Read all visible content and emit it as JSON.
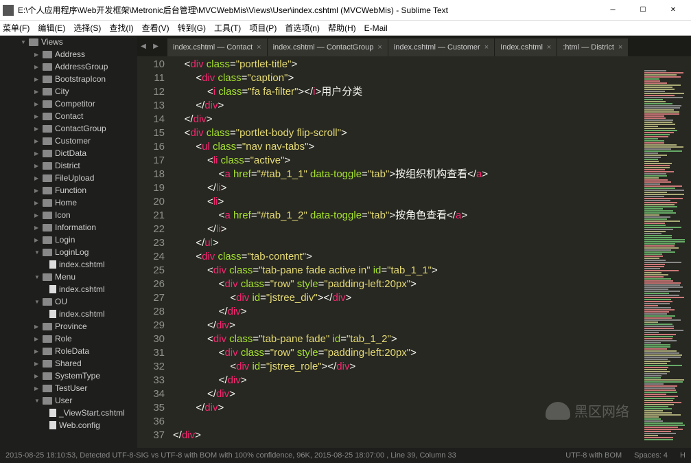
{
  "window": {
    "title": "E:\\个人应用程序\\Web开发框架\\Metronic后台管理\\MVCWebMis\\Views\\User\\index.cshtml (MVCWebMis) - Sublime Text"
  },
  "menu": [
    "菜单(F)",
    "编辑(E)",
    "选择(S)",
    "查找(I)",
    "查看(V)",
    "转到(G)",
    "工具(T)",
    "项目(P)",
    "首选项(n)",
    "帮助(H)",
    "E-Mail"
  ],
  "sidebar": {
    "root": "Views",
    "items": [
      {
        "type": "folder",
        "name": "Address",
        "depth": 2,
        "open": false
      },
      {
        "type": "folder",
        "name": "AddressGroup",
        "depth": 2,
        "open": false
      },
      {
        "type": "folder",
        "name": "BootstrapIcon",
        "depth": 2,
        "open": false
      },
      {
        "type": "folder",
        "name": "City",
        "depth": 2,
        "open": false
      },
      {
        "type": "folder",
        "name": "Competitor",
        "depth": 2,
        "open": false
      },
      {
        "type": "folder",
        "name": "Contact",
        "depth": 2,
        "open": false
      },
      {
        "type": "folder",
        "name": "ContactGroup",
        "depth": 2,
        "open": false
      },
      {
        "type": "folder",
        "name": "Customer",
        "depth": 2,
        "open": false
      },
      {
        "type": "folder",
        "name": "DictData",
        "depth": 2,
        "open": false
      },
      {
        "type": "folder",
        "name": "District",
        "depth": 2,
        "open": false
      },
      {
        "type": "folder",
        "name": "FileUpload",
        "depth": 2,
        "open": false
      },
      {
        "type": "folder",
        "name": "Function",
        "depth": 2,
        "open": false
      },
      {
        "type": "folder",
        "name": "Home",
        "depth": 2,
        "open": false
      },
      {
        "type": "folder",
        "name": "Icon",
        "depth": 2,
        "open": false
      },
      {
        "type": "folder",
        "name": "Information",
        "depth": 2,
        "open": false
      },
      {
        "type": "folder",
        "name": "Login",
        "depth": 2,
        "open": false
      },
      {
        "type": "folder",
        "name": "LoginLog",
        "depth": 2,
        "open": true
      },
      {
        "type": "file",
        "name": "index.cshtml",
        "depth": 3
      },
      {
        "type": "folder",
        "name": "Menu",
        "depth": 2,
        "open": true
      },
      {
        "type": "file",
        "name": "index.cshtml",
        "depth": 3
      },
      {
        "type": "folder",
        "name": "OU",
        "depth": 2,
        "open": true
      },
      {
        "type": "file",
        "name": "index.cshtml",
        "depth": 3
      },
      {
        "type": "folder",
        "name": "Province",
        "depth": 2,
        "open": false
      },
      {
        "type": "folder",
        "name": "Role",
        "depth": 2,
        "open": false
      },
      {
        "type": "folder",
        "name": "RoleData",
        "depth": 2,
        "open": false
      },
      {
        "type": "folder",
        "name": "Shared",
        "depth": 2,
        "open": false
      },
      {
        "type": "folder",
        "name": "SystemType",
        "depth": 2,
        "open": false
      },
      {
        "type": "folder",
        "name": "TestUser",
        "depth": 2,
        "open": false
      },
      {
        "type": "folder",
        "name": "User",
        "depth": 2,
        "open": true
      },
      {
        "type": "file",
        "name": "_ViewStart.cshtml",
        "depth": 3
      },
      {
        "type": "file",
        "name": "Web.config",
        "depth": 3
      }
    ]
  },
  "tabs": [
    {
      "label": "index.cshtml — Contact",
      "active": false
    },
    {
      "label": "index.cshtml — ContactGroup",
      "active": false
    },
    {
      "label": "index.cshtml — Customer",
      "active": false
    },
    {
      "label": "Index.cshtml",
      "active": false
    },
    {
      "label": ":html — District",
      "active": false
    }
  ],
  "gutter_start": 10,
  "gutter_end": 37,
  "code_lines": [
    [
      [
        "    <",
        "punc"
      ],
      [
        "div",
        "tag"
      ],
      [
        " ",
        "punc"
      ],
      [
        "class",
        "attr"
      ],
      [
        "=",
        "punc"
      ],
      [
        "\"portlet-title\"",
        "str"
      ],
      [
        ">",
        "punc"
      ]
    ],
    [
      [
        "        <",
        "punc"
      ],
      [
        "div",
        "tag"
      ],
      [
        " ",
        "punc"
      ],
      [
        "class",
        "attr"
      ],
      [
        "=",
        "punc"
      ],
      [
        "\"caption\"",
        "str"
      ],
      [
        ">",
        "punc"
      ]
    ],
    [
      [
        "            <",
        "punc"
      ],
      [
        "i",
        "tag"
      ],
      [
        " ",
        "punc"
      ],
      [
        "class",
        "attr"
      ],
      [
        "=",
        "punc"
      ],
      [
        "\"fa fa-filter\"",
        "str"
      ],
      [
        "></",
        "punc"
      ],
      [
        "i",
        "tag"
      ],
      [
        ">用户分类",
        "text"
      ]
    ],
    [
      [
        "        </",
        "punc"
      ],
      [
        "div",
        "tag"
      ],
      [
        ">",
        "punc"
      ]
    ],
    [
      [
        "    </",
        "punc"
      ],
      [
        "div",
        "tag"
      ],
      [
        ">",
        "punc"
      ]
    ],
    [
      [
        "    <",
        "punc"
      ],
      [
        "div",
        "tag"
      ],
      [
        " ",
        "punc"
      ],
      [
        "class",
        "attr"
      ],
      [
        "=",
        "punc"
      ],
      [
        "\"portlet-body flip-scroll\"",
        "str"
      ],
      [
        ">",
        "punc"
      ]
    ],
    [
      [
        "        <",
        "punc"
      ],
      [
        "ul",
        "tag"
      ],
      [
        " ",
        "punc"
      ],
      [
        "class",
        "attr"
      ],
      [
        "=",
        "punc"
      ],
      [
        "\"nav nav-tabs\"",
        "str"
      ],
      [
        ">",
        "punc"
      ]
    ],
    [
      [
        "            <",
        "punc"
      ],
      [
        "li",
        "tag"
      ],
      [
        " ",
        "punc"
      ],
      [
        "class",
        "attr"
      ],
      [
        "=",
        "punc"
      ],
      [
        "\"active\"",
        "str"
      ],
      [
        ">",
        "punc"
      ]
    ],
    [
      [
        "                <",
        "punc"
      ],
      [
        "a",
        "tag"
      ],
      [
        " ",
        "punc"
      ],
      [
        "href",
        "attr"
      ],
      [
        "=",
        "punc"
      ],
      [
        "\"#tab_1_1\"",
        "str"
      ],
      [
        " ",
        "punc"
      ],
      [
        "data-toggle",
        "attr"
      ],
      [
        "=",
        "punc"
      ],
      [
        "\"tab\"",
        "str"
      ],
      [
        ">按组织机构查看</",
        "text"
      ],
      [
        "a",
        "tag"
      ],
      [
        ">",
        "punc"
      ]
    ],
    [
      [
        "            </",
        "punc"
      ],
      [
        "li",
        "tag"
      ],
      [
        ">",
        "punc"
      ]
    ],
    [
      [
        "            <",
        "punc"
      ],
      [
        "li",
        "tag"
      ],
      [
        ">",
        "punc"
      ]
    ],
    [
      [
        "                <",
        "punc"
      ],
      [
        "a",
        "tag"
      ],
      [
        " ",
        "punc"
      ],
      [
        "href",
        "attr"
      ],
      [
        "=",
        "punc"
      ],
      [
        "\"#tab_1_2\"",
        "str"
      ],
      [
        " ",
        "punc"
      ],
      [
        "data-toggle",
        "attr"
      ],
      [
        "=",
        "punc"
      ],
      [
        "\"tab\"",
        "str"
      ],
      [
        ">按角色查看</",
        "text"
      ],
      [
        "a",
        "tag"
      ],
      [
        ">",
        "punc"
      ]
    ],
    [
      [
        "            </",
        "punc"
      ],
      [
        "li",
        "tag"
      ],
      [
        ">",
        "punc"
      ]
    ],
    [
      [
        "        </",
        "punc"
      ],
      [
        "ul",
        "tag"
      ],
      [
        ">",
        "punc"
      ]
    ],
    [
      [
        "        <",
        "punc"
      ],
      [
        "div",
        "tag"
      ],
      [
        " ",
        "punc"
      ],
      [
        "class",
        "attr"
      ],
      [
        "=",
        "punc"
      ],
      [
        "\"tab-content\"",
        "str"
      ],
      [
        ">",
        "punc"
      ]
    ],
    [
      [
        "            <",
        "punc"
      ],
      [
        "div",
        "tag"
      ],
      [
        " ",
        "punc"
      ],
      [
        "class",
        "attr"
      ],
      [
        "=",
        "punc"
      ],
      [
        "\"tab-pane fade active in\"",
        "str"
      ],
      [
        " ",
        "punc"
      ],
      [
        "id",
        "attr"
      ],
      [
        "=",
        "punc"
      ],
      [
        "\"tab_1_1\"",
        "str"
      ],
      [
        ">",
        "punc"
      ]
    ],
    [
      [
        "                <",
        "punc"
      ],
      [
        "div",
        "tag"
      ],
      [
        " ",
        "punc"
      ],
      [
        "class",
        "attr"
      ],
      [
        "=",
        "punc"
      ],
      [
        "\"row\"",
        "str"
      ],
      [
        " ",
        "punc"
      ],
      [
        "style",
        "attr"
      ],
      [
        "=",
        "punc"
      ],
      [
        "\"padding-left:20px\"",
        "str"
      ],
      [
        ">",
        "punc"
      ]
    ],
    [
      [
        "                    <",
        "punc"
      ],
      [
        "div",
        "tag"
      ],
      [
        " ",
        "punc"
      ],
      [
        "id",
        "attr"
      ],
      [
        "=",
        "punc"
      ],
      [
        "\"jstree_div\"",
        "str"
      ],
      [
        "></",
        "punc"
      ],
      [
        "div",
        "tag"
      ],
      [
        ">",
        "punc"
      ]
    ],
    [
      [
        "                </",
        "punc"
      ],
      [
        "div",
        "tag"
      ],
      [
        ">",
        "punc"
      ]
    ],
    [
      [
        "            </",
        "punc"
      ],
      [
        "div",
        "tag"
      ],
      [
        ">",
        "punc"
      ]
    ],
    [
      [
        "            <",
        "punc"
      ],
      [
        "div",
        "tag"
      ],
      [
        " ",
        "punc"
      ],
      [
        "class",
        "attr"
      ],
      [
        "=",
        "punc"
      ],
      [
        "\"tab-pane fade\"",
        "str"
      ],
      [
        " ",
        "punc"
      ],
      [
        "id",
        "attr"
      ],
      [
        "=",
        "punc"
      ],
      [
        "\"tab_1_2\"",
        "str"
      ],
      [
        ">",
        "punc"
      ]
    ],
    [
      [
        "                <",
        "punc"
      ],
      [
        "div",
        "tag"
      ],
      [
        " ",
        "punc"
      ],
      [
        "class",
        "attr"
      ],
      [
        "=",
        "punc"
      ],
      [
        "\"row\"",
        "str"
      ],
      [
        " ",
        "punc"
      ],
      [
        "style",
        "attr"
      ],
      [
        "=",
        "punc"
      ],
      [
        "\"padding-left:20px\"",
        "str"
      ],
      [
        ">",
        "punc"
      ]
    ],
    [
      [
        "                    <",
        "punc"
      ],
      [
        "div",
        "tag"
      ],
      [
        " ",
        "punc"
      ],
      [
        "id",
        "attr"
      ],
      [
        "=",
        "punc"
      ],
      [
        "\"jstree_role\"",
        "str"
      ],
      [
        "></",
        "punc"
      ],
      [
        "div",
        "tag"
      ],
      [
        ">",
        "punc"
      ]
    ],
    [
      [
        "                </",
        "punc"
      ],
      [
        "div",
        "tag"
      ],
      [
        ">",
        "punc"
      ]
    ],
    [
      [
        "            </",
        "punc"
      ],
      [
        "div",
        "tag"
      ],
      [
        ">",
        "punc"
      ]
    ],
    [
      [
        "        </",
        "punc"
      ],
      [
        "div",
        "tag"
      ],
      [
        ">",
        "punc"
      ]
    ],
    [
      [
        "",
        "punc"
      ]
    ],
    [
      [
        "</",
        "punc"
      ],
      [
        "div",
        "tag"
      ],
      [
        ">",
        "punc"
      ]
    ]
  ],
  "status": {
    "left": "2015-08-25 18:10:53, Detected UTF-8-SIG vs UTF-8 with BOM with 100% confidence, 96K, 2015-08-25 18:07:00 , Line 39, Column 33",
    "encoding": "UTF-8 with BOM",
    "spaces": "Spaces: 4",
    "syntax": "H"
  },
  "watermark": "黑区网络"
}
